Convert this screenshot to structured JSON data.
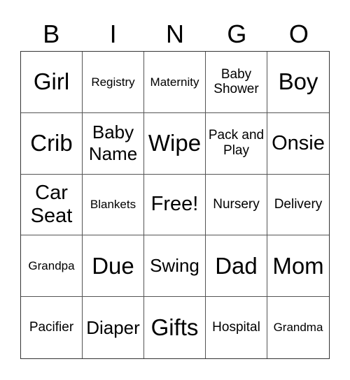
{
  "header": [
    "B",
    "I",
    "N",
    "G",
    "O"
  ],
  "cells": [
    {
      "text": "Girl",
      "size": "s-xl"
    },
    {
      "text": "Registry",
      "size": "s-xs"
    },
    {
      "text": "Maternity",
      "size": "s-xs"
    },
    {
      "text": "Baby Shower",
      "size": "s-s"
    },
    {
      "text": "Boy",
      "size": "s-xl"
    },
    {
      "text": "Crib",
      "size": "s-xl"
    },
    {
      "text": "Baby Name",
      "size": "s-m"
    },
    {
      "text": "Wipe",
      "size": "s-xl"
    },
    {
      "text": "Pack and Play",
      "size": "s-s"
    },
    {
      "text": "Onsie",
      "size": "s-l"
    },
    {
      "text": "Car Seat",
      "size": "s-l"
    },
    {
      "text": "Blankets",
      "size": "s-xs"
    },
    {
      "text": "Free!",
      "size": "s-l"
    },
    {
      "text": "Nursery",
      "size": "s-s"
    },
    {
      "text": "Delivery",
      "size": "s-s"
    },
    {
      "text": "Grandpa",
      "size": "s-xs"
    },
    {
      "text": "Due",
      "size": "s-xl"
    },
    {
      "text": "Swing",
      "size": "s-m"
    },
    {
      "text": "Dad",
      "size": "s-xl"
    },
    {
      "text": "Mom",
      "size": "s-xl"
    },
    {
      "text": "Pacifier",
      "size": "s-s"
    },
    {
      "text": "Diaper",
      "size": "s-m"
    },
    {
      "text": "Gifts",
      "size": "s-xl"
    },
    {
      "text": "Hospital",
      "size": "s-s"
    },
    {
      "text": "Grandma",
      "size": "s-xs"
    }
  ]
}
